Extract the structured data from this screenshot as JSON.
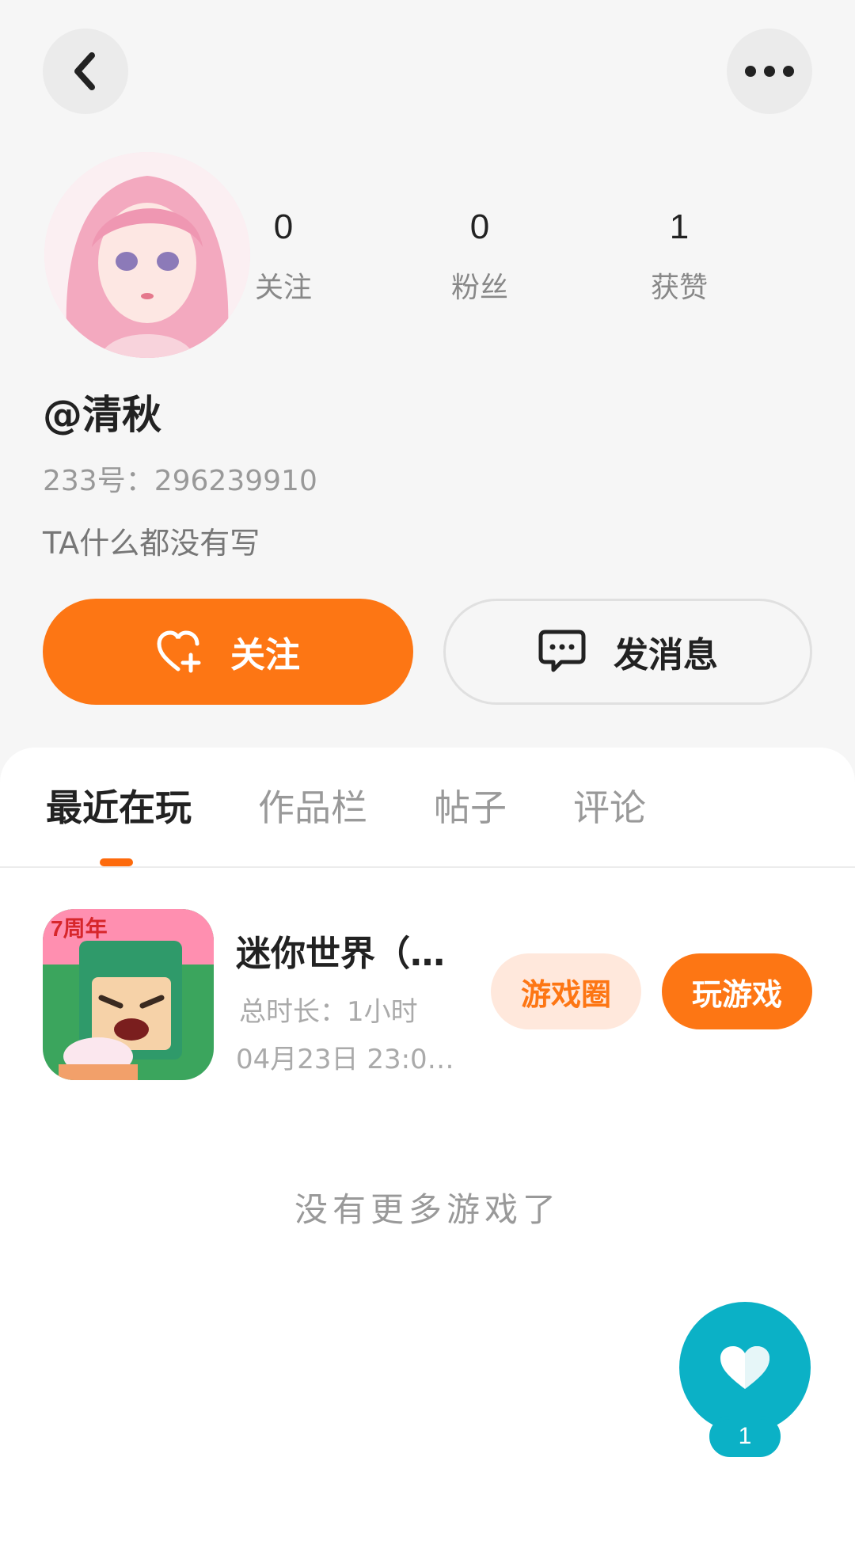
{
  "nav": {
    "back_icon": "chevron-left-icon",
    "more_icon": "more-horizontal-icon"
  },
  "profile": {
    "username": "@清秋",
    "account_id": "233号：296239910",
    "bio": "TA什么都没有写",
    "stats": {
      "following": {
        "value": "0",
        "label": "关注"
      },
      "fans": {
        "value": "0",
        "label": "粉丝"
      },
      "likes": {
        "value": "1",
        "label": "获赞"
      }
    }
  },
  "actions": {
    "follow_label": "关注",
    "message_label": "发消息"
  },
  "tabs": [
    {
      "label": "最近在玩"
    },
    {
      "label": "作品栏"
    },
    {
      "label": "帖子"
    },
    {
      "label": "评论"
    }
  ],
  "games": [
    {
      "title": "迷你世界（…",
      "duration": "总时长：1小时",
      "last_played": "04月23日 23:0…",
      "icon_badge": "7周年",
      "circle_label": "游戏圈",
      "play_label": "玩游戏"
    }
  ],
  "empty_text": "没有更多游戏了",
  "fab": {
    "count": "1"
  },
  "colors": {
    "accent": "#fd7614",
    "fab": "#0bb1c6"
  }
}
